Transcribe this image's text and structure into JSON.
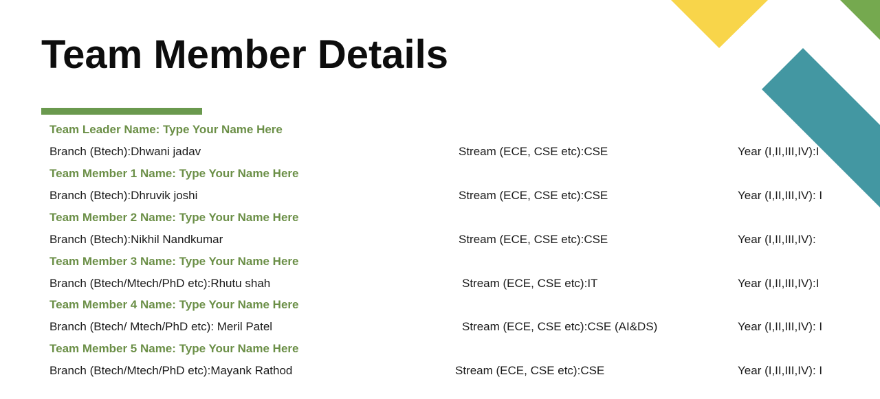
{
  "page": {
    "title": "Team Member Details",
    "colors": {
      "accent_green": "#6a994e",
      "name_green": "#6b8f47",
      "deco_yellow": "#f8d54a",
      "deco_teal": "#4397a2",
      "deco_green": "#75a94f"
    }
  },
  "members": [
    {
      "name": "Team Leader Name: Type Your Name Here",
      "branch": "Branch (Btech):Dhwani jadav",
      "stream": "Stream (ECE, CSE etc):CSE",
      "year": "Year (I,II,III,IV):I"
    },
    {
      "name": "Team Member 1 Name: Type Your Name Here",
      "branch": "Branch (Btech):Dhruvik joshi",
      "stream": "Stream (ECE, CSE etc):CSE",
      "year": "Year (I,II,III,IV): I"
    },
    {
      "name": "Team Member 2 Name: Type Your Name Here",
      "branch": "Branch (Btech):Nikhil Nandkumar",
      "stream": "Stream (ECE, CSE etc):CSE",
      "year": "Year (I,II,III,IV):"
    },
    {
      "name": "Team Member 3 Name: Type Your Name Here",
      "branch": "Branch (Btech/Mtech/PhD etc):Rhutu shah",
      "stream": "Stream (ECE, CSE etc):IT",
      "year": "Year (I,II,III,IV):I"
    },
    {
      "name": "Team Member 4 Name: Type Your Name Here",
      "branch": "Branch (Btech/ Mtech/PhD etc): Meril Patel",
      "stream": "Stream (ECE, CSE etc):CSE (AI&DS)",
      "year": "Year (I,II,III,IV): I"
    },
    {
      "name": "Team Member 5 Name: Type Your Name Here",
      "branch": "Branch (Btech/Mtech/PhD etc):Mayank  Rathod",
      "stream": "Stream (ECE, CSE etc):CSE",
      "year": "Year (I,II,III,IV): I"
    }
  ]
}
